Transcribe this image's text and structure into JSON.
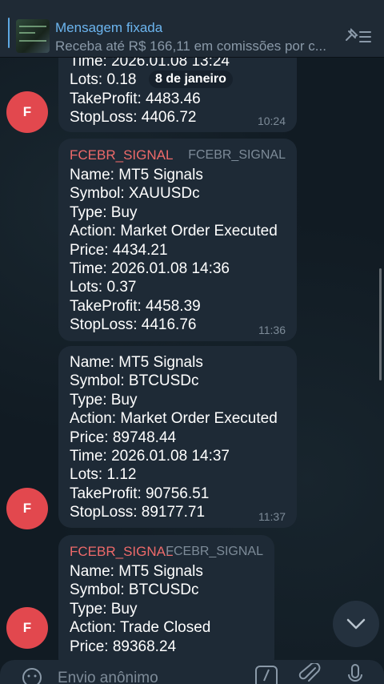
{
  "pinned": {
    "title": "Mensagem fixada",
    "text": "Receba até R$ 166,11 em comissões por c..."
  },
  "date_pill": "8 de janeiro",
  "messages": [
    {
      "lines": [
        "Time: 2026.01.08 13:24",
        "Lots: 0.18",
        "TakeProfit: 4483.46",
        "StopLoss: 4406.72"
      ],
      "time": "10:24",
      "avatar": "F"
    },
    {
      "sender": "FCEBR_SIGNAL",
      "signature": "FCEBR_SIGNAL",
      "lines": [
        "Name: MT5 Signals",
        "Symbol: XAUUSDc",
        "Type: Buy",
        "Action: Market Order Executed",
        "Price: 4434.21",
        "Time: 2026.01.08 14:36",
        "Lots: 0.37",
        "TakeProfit: 4458.39",
        "StopLoss: 4416.76"
      ],
      "time": "11:36"
    },
    {
      "lines": [
        "Name: MT5 Signals",
        "Symbol: BTCUSDc",
        "Type: Buy",
        "Action: Market Order Executed",
        "Price: 89748.44",
        "Time: 2026.01.08 14:37",
        "Lots: 1.12",
        "TakeProfit: 90756.51",
        "StopLoss: 89177.71"
      ],
      "time": "11:37",
      "avatar": "F"
    },
    {
      "sender": "FCEBR_SIGNAL",
      "signature": "FCEBR_SIGNAL",
      "lines": [
        "Name: MT5 Signals",
        "Symbol: BTCUSDc",
        "Type: Buy",
        "Action: Trade Closed",
        "Price: 89368.24"
      ],
      "avatar": "F"
    }
  ],
  "input": {
    "placeholder": "Envio anônimo"
  },
  "icons": {
    "pin": "pin-list-icon",
    "scroll": "chevron-down-icon",
    "emoji": "emoji-icon",
    "commands": "slash-command-icon",
    "attach": "paperclip-icon",
    "mic": "microphone-icon"
  },
  "colors": {
    "accent": "#6cb5ef",
    "sender": "#ee6a6a",
    "avatar": "#e2484e",
    "bubble": "#1e2a36"
  }
}
